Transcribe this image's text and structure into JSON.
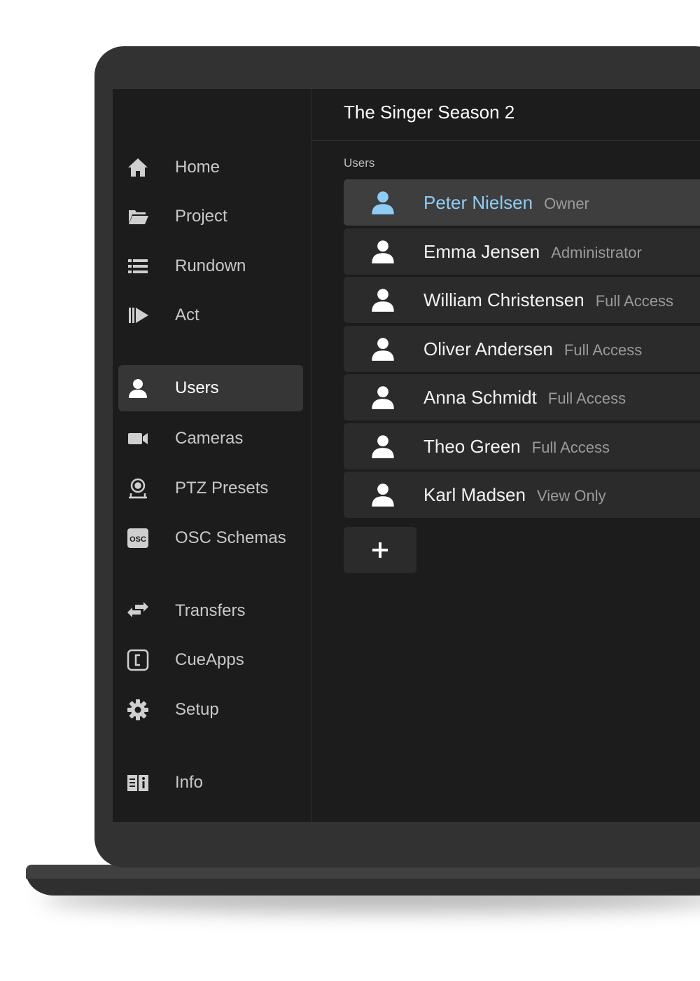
{
  "project": {
    "title": "The Singer Season 2"
  },
  "sidebar": {
    "items": [
      {
        "label": "Home",
        "icon": "home-icon"
      },
      {
        "label": "Project",
        "icon": "folder-icon"
      },
      {
        "label": "Rundown",
        "icon": "list-icon"
      },
      {
        "label": "Act",
        "icon": "play-icon"
      },
      {
        "label": "Users",
        "icon": "user-icon",
        "active": true
      },
      {
        "label": "Cameras",
        "icon": "camera-icon"
      },
      {
        "label": "PTZ Presets",
        "icon": "ptz-camera-icon"
      },
      {
        "label": "OSC Schemas",
        "icon": "osc-icon",
        "icon_text": "OSC"
      },
      {
        "label": "Transfers",
        "icon": "transfer-arrows-icon"
      },
      {
        "label": "CueApps",
        "icon": "cueapps-icon"
      },
      {
        "label": "Setup",
        "icon": "gear-icon"
      },
      {
        "label": "Info",
        "icon": "info-book-icon"
      }
    ]
  },
  "users_section": {
    "label": "Users",
    "users": [
      {
        "name": "Peter Nielsen",
        "role": "Owner",
        "selected": true
      },
      {
        "name": "Emma Jensen",
        "role": "Administrator"
      },
      {
        "name": "William Christensen",
        "role": "Full Access"
      },
      {
        "name": "Oliver Andersen",
        "role": "Full Access"
      },
      {
        "name": "Anna Schmidt",
        "role": "Full Access"
      },
      {
        "name": "Theo Green",
        "role": "Full Access"
      },
      {
        "name": "Karl Madsen",
        "role": "View Only"
      }
    ],
    "add_button": {
      "icon": "plus-icon"
    }
  },
  "colors": {
    "screen_bg": "#1c1c1c",
    "row_bg": "#2b2b2b",
    "row_selected_bg": "#3e3e3e",
    "accent": "#8ecdf3",
    "bezel": "#323232"
  }
}
